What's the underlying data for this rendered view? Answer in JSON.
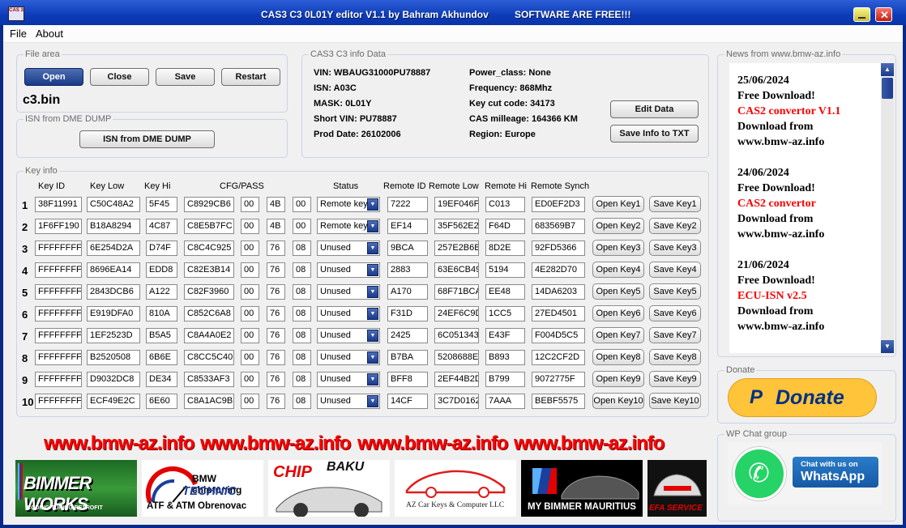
{
  "window": {
    "icon_text": "CAS 3",
    "title": "CAS3 C3 0L01Y editor V1.1 by Bahram Akhundov",
    "title_note": "SOFTWARE ARE FREE!!!"
  },
  "menu": [
    "File",
    "About"
  ],
  "file_area": {
    "legend": "File area",
    "buttons": [
      "Open",
      "Close",
      "Save",
      "Restart"
    ],
    "filename": "c3.bin"
  },
  "isn_area": {
    "legend": "ISN from DME DUMP",
    "button": "ISN from DME DUMP"
  },
  "info": {
    "legend": "CAS3 C3 info Data",
    "left": [
      "VIN:  WBAUG31000PU78887",
      "ISN:  A03C",
      "MASK:  0L01Y",
      "Short VIN:  PU78887",
      "Prod Date:  26102006"
    ],
    "right": [
      "Power_class:  None",
      "Frequency:  868Mhz",
      "Key cut code:  34173",
      "CAS milleage:  164366 KM",
      "Region:  Europe"
    ],
    "buttons": [
      "Edit Data",
      "Save Info to TXT"
    ]
  },
  "keys": {
    "legend": "Key info",
    "headers": [
      "Key ID",
      "Key Low",
      "Key Hi",
      "CFG/PASS",
      "Status",
      "Remote ID",
      "Remote Low",
      "Remote Hi",
      "Remote Synch"
    ],
    "rows": [
      {
        "n": "1",
        "id": "38F11991",
        "low": "C50C48A2",
        "hi": "5F45",
        "cfg": "C8929CB6",
        "c1": "00",
        "c2": "4B",
        "c3": "00",
        "status": "Remote key",
        "rid": "7222",
        "rlow": "19EF046F",
        "rhi": "C013",
        "rsync": "ED0EF2D3",
        "open": "Open Key1",
        "save": "Save Key1"
      },
      {
        "n": "2",
        "id": "1F6FF190",
        "low": "B18A8294",
        "hi": "4C87",
        "cfg": "C8E5B7FC",
        "c1": "00",
        "c2": "4B",
        "c3": "00",
        "status": "Remote key",
        "rid": "EF14",
        "rlow": "35F562E2",
        "rhi": "F64D",
        "rsync": "683569B7",
        "open": "Open Key2",
        "save": "Save Key2"
      },
      {
        "n": "3",
        "id": "FFFFFFFF",
        "low": "6E254D2A",
        "hi": "D74F",
        "cfg": "C8C4C925",
        "c1": "00",
        "c2": "76",
        "c3": "08",
        "status": "Unused",
        "rid": "9BCA",
        "rlow": "257E2B6B",
        "rhi": "8D2E",
        "rsync": "92FD5366",
        "open": "Open Key3",
        "save": "Save Key3"
      },
      {
        "n": "4",
        "id": "FFFFFFFF",
        "low": "8696EA14",
        "hi": "EDD8",
        "cfg": "C82E3B14",
        "c1": "00",
        "c2": "76",
        "c3": "08",
        "status": "Unused",
        "rid": "2883",
        "rlow": "63E6CB49",
        "rhi": "5194",
        "rsync": "4E282D70",
        "open": "Open Key4",
        "save": "Save Key4"
      },
      {
        "n": "5",
        "id": "FFFFFFFF",
        "low": "2843DCB6",
        "hi": "A122",
        "cfg": "C82F3960",
        "c1": "00",
        "c2": "76",
        "c3": "08",
        "status": "Unused",
        "rid": "A170",
        "rlow": "68F71BCA",
        "rhi": "EE48",
        "rsync": "14DA6203",
        "open": "Open Key5",
        "save": "Save Key5"
      },
      {
        "n": "6",
        "id": "FFFFFFFF",
        "low": "E919DFA0",
        "hi": "810A",
        "cfg": "C852C6A8",
        "c1": "00",
        "c2": "76",
        "c3": "08",
        "status": "Unused",
        "rid": "F31D",
        "rlow": "24EF6C9D",
        "rhi": "1CC5",
        "rsync": "27ED4501",
        "open": "Open Key6",
        "save": "Save Key6"
      },
      {
        "n": "7",
        "id": "FFFFFFFF",
        "low": "1EF2523D",
        "hi": "B5A5",
        "cfg": "C8A4A0E2",
        "c1": "00",
        "c2": "76",
        "c3": "08",
        "status": "Unused",
        "rid": "2425",
        "rlow": "6C051343",
        "rhi": "E43F",
        "rsync": "F004D5C5",
        "open": "Open Key7",
        "save": "Save Key7"
      },
      {
        "n": "8",
        "id": "FFFFFFFF",
        "low": "B2520508",
        "hi": "6B6E",
        "cfg": "C8CC5C40",
        "c1": "00",
        "c2": "76",
        "c3": "08",
        "status": "Unused",
        "rid": "B7BA",
        "rlow": "5208688E",
        "rhi": "B893",
        "rsync": "12C2CF2D",
        "open": "Open Key8",
        "save": "Save Key8"
      },
      {
        "n": "9",
        "id": "FFFFFFFF",
        "low": "D9032DC8",
        "hi": "DE34",
        "cfg": "C8533AF3",
        "c1": "00",
        "c2": "76",
        "c3": "08",
        "status": "Unused",
        "rid": "BFF8",
        "rlow": "2EF44B2D",
        "rhi": "B799",
        "rsync": "9072775F",
        "open": "Open Key9",
        "save": "Save Key9"
      },
      {
        "n": "10",
        "id": "FFFFFFFF",
        "low": "ECF49E2C",
        "hi": "6E60",
        "cfg": "C8A1AC9B",
        "c1": "00",
        "c2": "76",
        "c3": "08",
        "status": "Unused",
        "rid": "14CF",
        "rlow": "3C7D0162",
        "rhi": "7AAA",
        "rsync": "BEBF5575",
        "open": "Open Key10",
        "save": "Save Key10"
      }
    ]
  },
  "links": [
    "www.bmw-az.info",
    "www.bmw-az.info",
    "www.bmw-az.info",
    "www.bmw-az.info"
  ],
  "sponsors": [
    {
      "name": "BIMMER WORKS",
      "sub": "CODING TUNING RETROFIT"
    },
    {
      "name": "BMW chiptuning",
      "name2": "TECHNIC",
      "sub": "ATF & ATM Obrenovac"
    },
    {
      "name": "CHIP",
      "name2": "BAKU"
    },
    {
      "name": "AZ Car Keys & Computer LLC"
    },
    {
      "name": "MY BIMMER MAURITIUS"
    },
    {
      "name": "EFA SERVICE"
    }
  ],
  "news": {
    "legend": "News from www.bmw-az.info",
    "items": [
      {
        "date": "25/06/2024",
        "line1": "Free Download!",
        "highlight": "CAS2 convertor V1.1",
        "line2": "Download from",
        "line3": "www.bmw-az.info"
      },
      {
        "date": "24/06/2024",
        "line1": "Free Download!",
        "highlight": "CAS2 convertor",
        "line2": "Download from",
        "line3": "www.bmw-az.info"
      },
      {
        "date": "21/06/2024",
        "line1": "Free Download!",
        "highlight": "ECU-ISN v2.5",
        "line2": "Download from",
        "line3": "www.bmw-az.info"
      }
    ]
  },
  "donate": {
    "legend": "Donate",
    "label": "Donate"
  },
  "wp": {
    "legend": "WP Chat group",
    "line1": "Chat with us on",
    "line2": "WhatsApp"
  },
  "colors": {
    "accent": "#0a34a8",
    "link_red": "#ff0000",
    "news_red": "#ff0000",
    "donate_bg": "#ffc439",
    "donate_text": "#003087",
    "whatsapp": "#25d366"
  }
}
